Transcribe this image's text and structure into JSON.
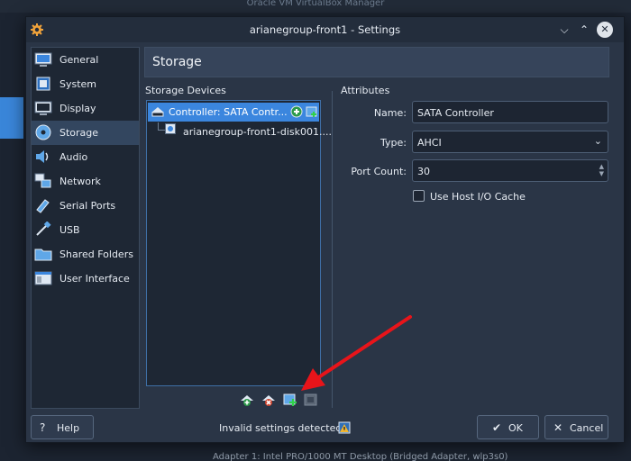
{
  "background": {
    "window_title": "Oracle VM VirtualBox Manager",
    "bottom_text": "Adapter 1:   Intel PRO/1000 MT Desktop (Bridged Adapter, wlp3s0)"
  },
  "dialog": {
    "title": "arianegroup-front1 - Settings"
  },
  "sidebar": {
    "items": [
      {
        "label": "General",
        "icon": "monitor-icon"
      },
      {
        "label": "System",
        "icon": "chip-icon"
      },
      {
        "label": "Display",
        "icon": "display-icon"
      },
      {
        "label": "Storage",
        "icon": "disk-icon"
      },
      {
        "label": "Audio",
        "icon": "speaker-icon"
      },
      {
        "label": "Network",
        "icon": "network-icon"
      },
      {
        "label": "Serial Ports",
        "icon": "serial-port-icon"
      },
      {
        "label": "USB",
        "icon": "usb-icon"
      },
      {
        "label": "Shared Folders",
        "icon": "folder-icon"
      },
      {
        "label": "User Interface",
        "icon": "window-icon"
      }
    ],
    "active": "Storage"
  },
  "page": {
    "title": "Storage",
    "storage_devices_label": "Storage Devices",
    "attributes_label": "Attributes"
  },
  "tree": {
    "controller_label": "Controller: SATA Contr...",
    "disk_label": "arianegroup-front1-disk001...."
  },
  "attributes": {
    "name_label": "Name:",
    "name_value": "SATA Controller",
    "type_label": "Type:",
    "type_value": "AHCI",
    "port_count_label": "Port Count:",
    "port_count_value": "30",
    "host_io_cache_label": "Use Host I/O Cache",
    "host_io_cache_checked": false
  },
  "footer": {
    "help_label": "Help",
    "invalid_text": "Invalid settings detected",
    "ok_label": "OK",
    "cancel_label": "Cancel"
  },
  "colors": {
    "accent": "#3b86de",
    "dialog_bg": "#2a3546",
    "arrow": "#e8141a"
  }
}
